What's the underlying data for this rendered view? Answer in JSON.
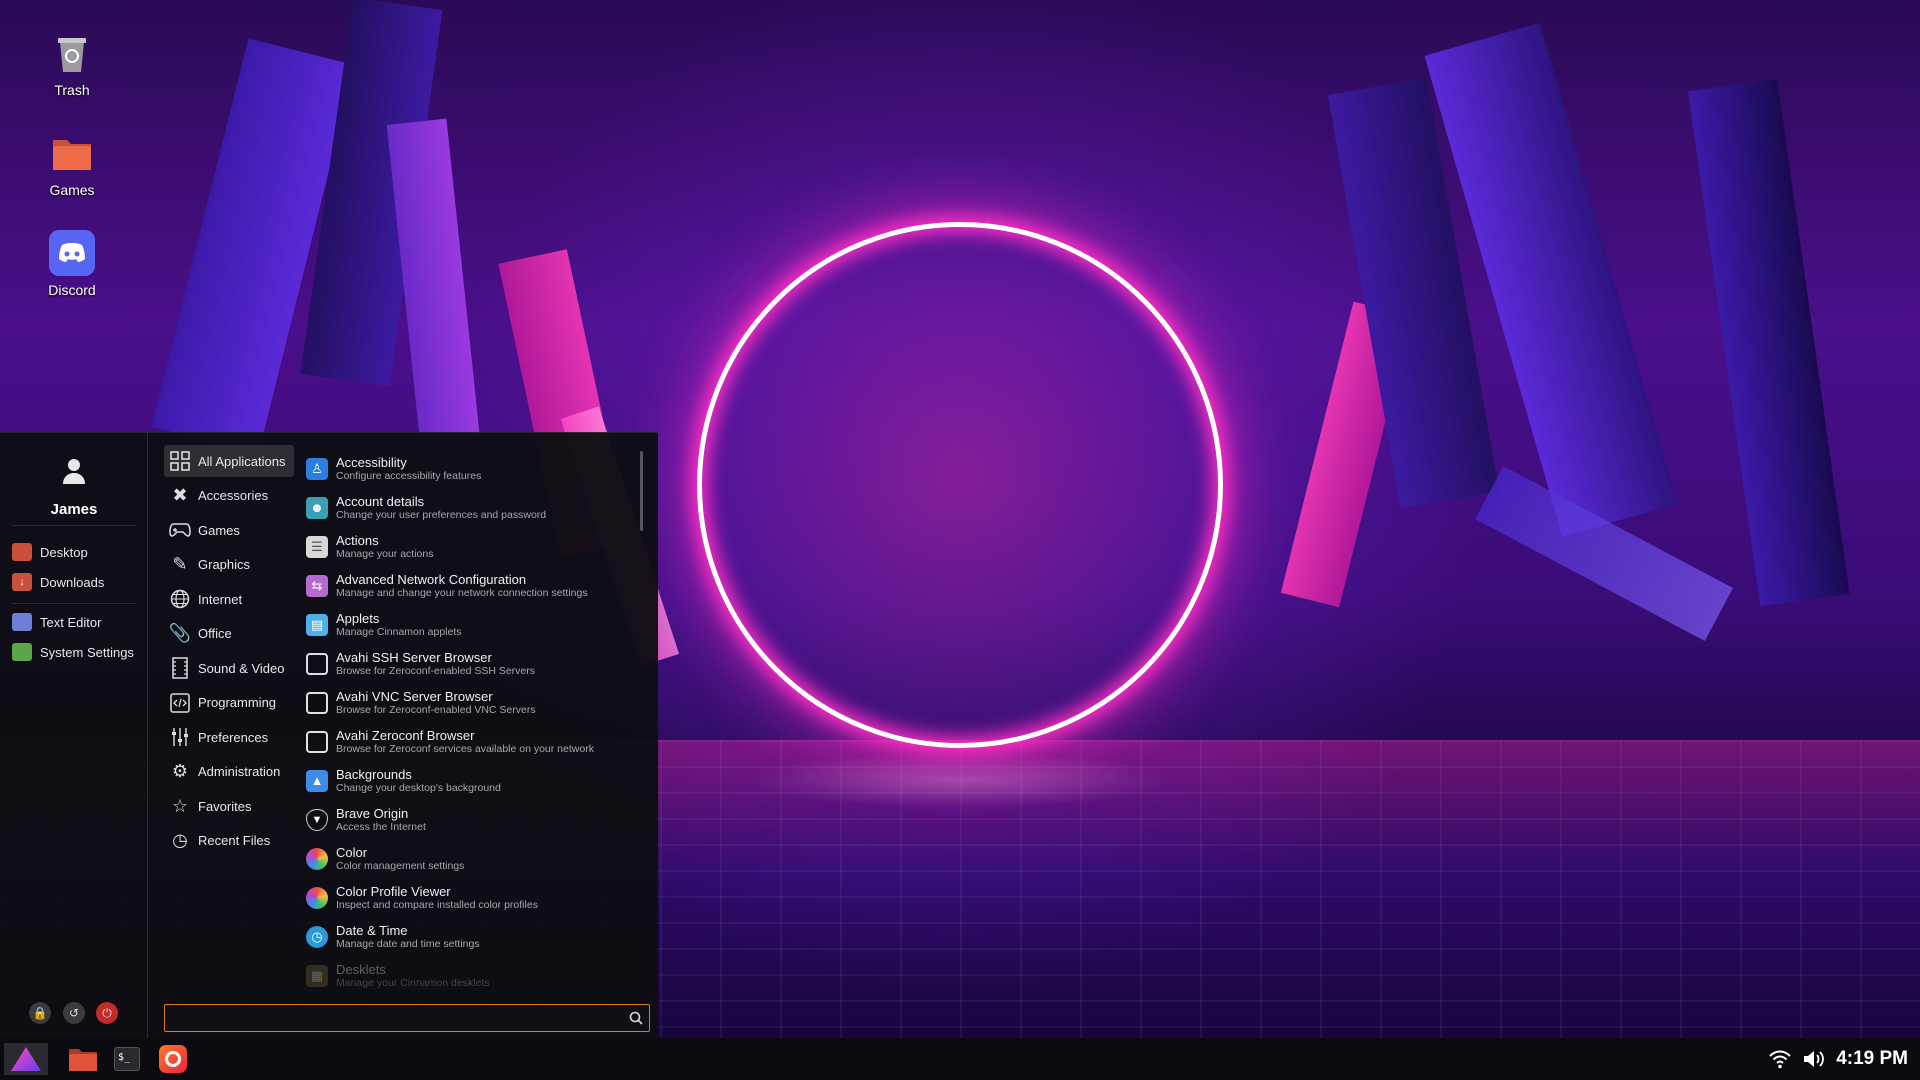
{
  "desktop": {
    "icons": [
      {
        "label": "Trash",
        "icon": "trash-icon"
      },
      {
        "label": "Games",
        "icon": "folder-icon"
      },
      {
        "label": "Discord",
        "icon": "discord-icon"
      }
    ]
  },
  "menu": {
    "user": {
      "name": "James"
    },
    "places": [
      {
        "label": "Desktop",
        "icon": "desktop-folder-icon"
      },
      {
        "label": "Downloads",
        "icon": "downloads-folder-icon"
      }
    ],
    "favorites": [
      {
        "label": "Text Editor",
        "icon": "text-editor-icon"
      },
      {
        "label": "System Settings",
        "icon": "system-settings-icon"
      }
    ],
    "session": [
      {
        "icon": "lock-icon"
      },
      {
        "icon": "logout-icon"
      },
      {
        "icon": "power-icon"
      }
    ],
    "categories": [
      {
        "label": "All Applications",
        "icon": "grid-icon",
        "active": true
      },
      {
        "label": "Accessories",
        "icon": "tools-icon"
      },
      {
        "label": "Games",
        "icon": "gamepad-icon"
      },
      {
        "label": "Graphics",
        "icon": "palette-icon"
      },
      {
        "label": "Internet",
        "icon": "globe-icon"
      },
      {
        "label": "Office",
        "icon": "paperclip-icon"
      },
      {
        "label": "Sound & Video",
        "icon": "film-icon"
      },
      {
        "label": "Programming",
        "icon": "code-icon"
      },
      {
        "label": "Preferences",
        "icon": "sliders-icon"
      },
      {
        "label": "Administration",
        "icon": "gear-icon"
      },
      {
        "label": "Favorites",
        "icon": "star-icon"
      },
      {
        "label": "Recent Files",
        "icon": "history-icon"
      }
    ],
    "apps": [
      {
        "name": "Accessibility",
        "desc": "Configure accessibility features",
        "icon": "accessibility-icon",
        "color": "#2a7de1"
      },
      {
        "name": "Account details",
        "desc": "Change your user preferences and password",
        "icon": "account-icon",
        "color": "#3aa0b8"
      },
      {
        "name": "Actions",
        "desc": "Manage your actions",
        "icon": "actions-icon",
        "color": "#d8d8d8"
      },
      {
        "name": "Advanced Network Configuration",
        "desc": "Manage and change your network connection settings",
        "icon": "network-icon",
        "color": "#b46ad1"
      },
      {
        "name": "Applets",
        "desc": "Manage Cinnamon applets",
        "icon": "applets-icon",
        "color": "#4fb0e8"
      },
      {
        "name": "Avahi SSH Server Browser",
        "desc": "Browse for Zeroconf-enabled SSH Servers",
        "icon": "monitor-icon",
        "color": "#e0e0e0"
      },
      {
        "name": "Avahi VNC Server Browser",
        "desc": "Browse for Zeroconf-enabled VNC Servers",
        "icon": "monitor-icon",
        "color": "#e0e0e0"
      },
      {
        "name": "Avahi Zeroconf Browser",
        "desc": "Browse for Zeroconf services available on your network",
        "icon": "monitor-icon",
        "color": "#e0e0e0"
      },
      {
        "name": "Backgrounds",
        "desc": "Change your desktop's background",
        "icon": "backgrounds-icon",
        "color": "#3a8ee6"
      },
      {
        "name": "Brave Origin",
        "desc": "Access the Internet",
        "icon": "brave-icon",
        "color": "#1a1a1a"
      },
      {
        "name": "Color",
        "desc": "Color management settings",
        "icon": "color-icon",
        "color": "#e86f3a"
      },
      {
        "name": "Color Profile Viewer",
        "desc": "Inspect and compare installed color profiles",
        "icon": "color-profile-icon",
        "color": "#d94f8a"
      },
      {
        "name": "Date & Time",
        "desc": "Manage date and time settings",
        "icon": "clock-icon",
        "color": "#2b9ad8"
      },
      {
        "name": "Desklets",
        "desc": "Manage your Cinnamon desklets",
        "icon": "desklets-icon",
        "color": "#7a6a30",
        "fade": true
      }
    ],
    "search": {
      "value": "",
      "placeholder": ""
    }
  },
  "taskbar": {
    "launchers": [
      {
        "icon": "menu-logo-icon"
      },
      {
        "icon": "files-icon"
      },
      {
        "icon": "terminal-icon"
      },
      {
        "icon": "firefox-icon"
      }
    ],
    "tray": {
      "time": "4:19 PM"
    }
  }
}
